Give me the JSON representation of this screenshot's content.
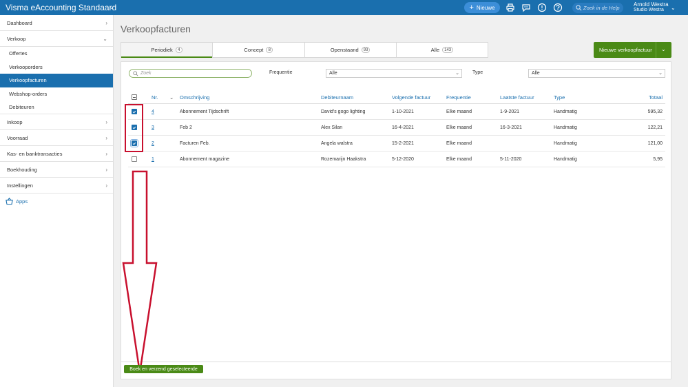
{
  "app": {
    "title": "Visma eAccounting Standaard"
  },
  "topbar": {
    "new_label": "Nieuwe",
    "help_placeholder": "Zoek in de Help",
    "user_name": "Arnold Westra",
    "user_company": "Studio Westra"
  },
  "sidebar": {
    "items": [
      {
        "label": "Dashboard"
      },
      {
        "label": "Verkoop"
      },
      {
        "label": "Inkoop"
      },
      {
        "label": "Voorraad"
      },
      {
        "label": "Kas- en banktransacties"
      },
      {
        "label": "Boekhouding"
      },
      {
        "label": "Instellingen"
      }
    ],
    "sub_items": [
      {
        "label": "Offertes"
      },
      {
        "label": "Verkooporders"
      },
      {
        "label": "Verkoopfacturen"
      },
      {
        "label": "Webshop-orders"
      },
      {
        "label": "Debiteuren"
      }
    ],
    "apps_label": "Apps"
  },
  "page": {
    "title": "Verkoopfacturen",
    "new_invoice_label": "Nieuwe verkoopfactuur"
  },
  "tabs": [
    {
      "label": "Periodiek",
      "count": "4"
    },
    {
      "label": "Concept",
      "count": "8"
    },
    {
      "label": "Openstaand",
      "count": "93"
    },
    {
      "label": "Alle",
      "count": "143"
    }
  ],
  "filters": {
    "search_placeholder": "Zoek",
    "frequency_label": "Frequentie",
    "frequency_value": "Alle",
    "type_label": "Type",
    "type_value": "Alle"
  },
  "table": {
    "headers": {
      "nr": "Nr.",
      "description": "Omschrijving",
      "debtor": "Debiteurnaam",
      "next_invoice": "Volgende factuur",
      "frequency": "Frequentie",
      "last_invoice": "Laatste factuur",
      "type": "Type",
      "total": "Totaal"
    },
    "rows": [
      {
        "nr": "4",
        "description": "Abonnement Tijdschrift",
        "debtor": "David's gogo lighting",
        "next_invoice": "1-10-2021",
        "frequency": "Elke maand",
        "last_invoice": "1-9-2021",
        "type": "Handmatig",
        "total": "595,32",
        "checked": true
      },
      {
        "nr": "3",
        "description": "Feb 2",
        "debtor": "Alex Silan",
        "next_invoice": "16-4-2021",
        "frequency": "Elke maand",
        "last_invoice": "16-3-2021",
        "type": "Handmatig",
        "total": "122,21",
        "checked": true
      },
      {
        "nr": "2",
        "description": "Facturen Feb.",
        "debtor": "Angela walstra",
        "next_invoice": "15-2-2021",
        "frequency": "Elke maand",
        "last_invoice": "",
        "type": "Handmatig",
        "total": "121,00",
        "checked": true
      },
      {
        "nr": "1",
        "description": "Abonnement magazine",
        "debtor": "Rozemarijn Haakstra",
        "next_invoice": "5-12-2020",
        "frequency": "Elke maand",
        "last_invoice": "5-11-2020",
        "type": "Handmatig",
        "total": "5,95",
        "checked": false
      }
    ]
  },
  "actions": {
    "book_send_label": "Boek en verzend geselecteerde"
  },
  "colors": {
    "brand": "#1a6fae",
    "primary_green": "#4a8a16",
    "annotation_red": "#c8102e"
  },
  "icons": [
    "chevron-down-icon",
    "plus-icon",
    "printer-icon",
    "chat-icon",
    "alert-icon",
    "help-icon",
    "search-icon",
    "chevron-right-icon",
    "apps-basket-icon",
    "checkmark-icon",
    "down-arrow-annotation"
  ]
}
